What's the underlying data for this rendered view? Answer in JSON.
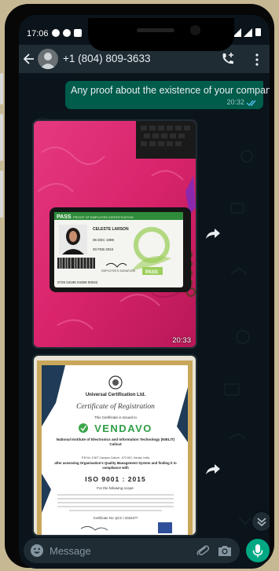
{
  "status_bar": {
    "time": "17:06"
  },
  "header": {
    "contact_phone": "+1 (804) 809-3633"
  },
  "messages": {
    "outgoing": {
      "text": "Any proof about the existence of your company?",
      "time": "20:32"
    },
    "image1": {
      "time": "20:33",
      "id_card": {
        "header": "PASS",
        "header_sub": "PROOF OF EMPLOYEE IDENTIFICATION",
        "name": "CELESTE LARSON",
        "field1": "06 DEC 1999",
        "field2": "20 FEB 2024",
        "signature_label": "EMPLOYEE'S SIGNATURE",
        "footer_code": "0725 04195 04359 00042",
        "badge": "PASS"
      }
    },
    "image2": {
      "certificate": {
        "issuer": "Universal Certification Ltd.",
        "title": "Certificate of Registration",
        "issued_to": "This Certificate is Issued to",
        "company": "VENDAVO",
        "org": "National Institute of Electronics and Information Technology (NIELIT) Calicut",
        "address": "P.B No. 5 NIT Campus Calicut - 673 601, Kerala, India",
        "assessment": "after assessing Organisation's Quality Management System and finding it in compliance with",
        "standard": "ISO 9001 : 2015",
        "scope_label": "For the following scope:",
        "cert_no": "Certificate No: QCC / 2022477"
      }
    }
  },
  "input": {
    "placeholder": "Message"
  },
  "colors": {
    "accent": "#00a884",
    "outgoing_bubble": "#005c4b",
    "header": "#1f2c34",
    "background": "#0b141a"
  }
}
